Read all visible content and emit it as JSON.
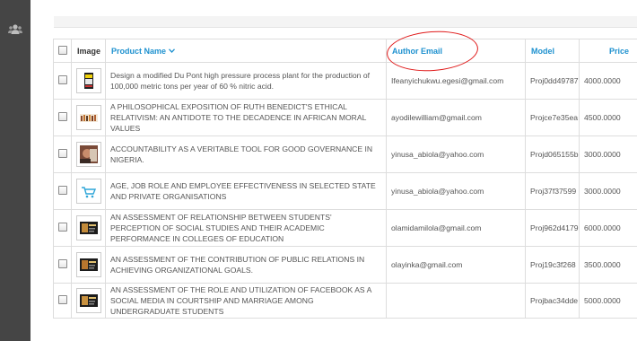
{
  "table": {
    "headers": {
      "image": "Image",
      "product_name": "Product Name",
      "author_email": "Author Email",
      "model": "Model",
      "price": "Price"
    },
    "rows": [
      {
        "name": "Design a modified Du Pont high pressure process plant for the production of 100,000 metric tons per year of 60 % nitric acid.",
        "email": "Ifeanyichukwu.egesi@gmail.com",
        "model": "Proj0dd49787",
        "price": "4000.0000",
        "thumb": "document-thumbnail"
      },
      {
        "name": "A PHILOSOPHICAL EXPOSITION OF RUTH BENEDICT'S ETHICAL RELATIVISM: AN ANTIDOTE TO THE DECADENCE IN AFRICAN MORAL VALUES",
        "email": "ayodilewilliam@gmail.com",
        "model": "Projce7e35ea",
        "price": "4500.0000",
        "thumb": "people-thumbnail"
      },
      {
        "name": "ACCOUNTABILITY AS A VERITABLE TOOL FOR GOOD GOVERNANCE IN NIGERIA.",
        "email": "yinusa_abiola@yahoo.com",
        "model": "Projd065155b",
        "price": "3000.0000",
        "thumb": "portrait-thumbnail"
      },
      {
        "name": "AGE, JOB ROLE AND EMPLOYEE EFFECTIVENESS IN SELECTED STATE AND PRIVATE ORGANISATIONS",
        "email": "yinusa_abiola@yahoo.com",
        "model": "Proj37f37599",
        "price": "3000.0000",
        "thumb": "cart-thumbnail"
      },
      {
        "name": "AN ASSESSMENT OF RELATIONSHIP BETWEEN STUDENTS' PERCEPTION OF SOCIAL STUDIES AND THEIR ACADEMIC PERFORMANCE IN COLLEGES OF EDUCATION",
        "email": "olamidamilola@gmail.com",
        "model": "Proj962d4179",
        "price": "6000.0000",
        "thumb": "book-thumbnail"
      },
      {
        "name": "AN ASSESSMENT OF THE CONTRIBUTION OF PUBLIC RELATIONS IN ACHIEVING ORGANIZATIONAL GOALS.",
        "email": "olayinka@gmail.com",
        "model": "Proj19c3f268",
        "price": "3500.0000",
        "thumb": "book-thumbnail"
      },
      {
        "name": "AN ASSESSMENT OF THE ROLE AND UTILIZATION OF FACEBOOK AS A SOCIAL MEDIA IN COURTSHIP AND MARRIAGE AMONG UNDERGRADUATE STUDENTS",
        "email": "",
        "model": "Projbac34dde",
        "price": "5000.0000",
        "thumb": "book-thumbnail"
      }
    ]
  },
  "colors": {
    "sidebar": "#454545",
    "link": "#1e91cf",
    "annotation": "#e01a1a"
  },
  "icons": {
    "sidebar": "users-icon",
    "sort": "chevron-down-icon"
  }
}
